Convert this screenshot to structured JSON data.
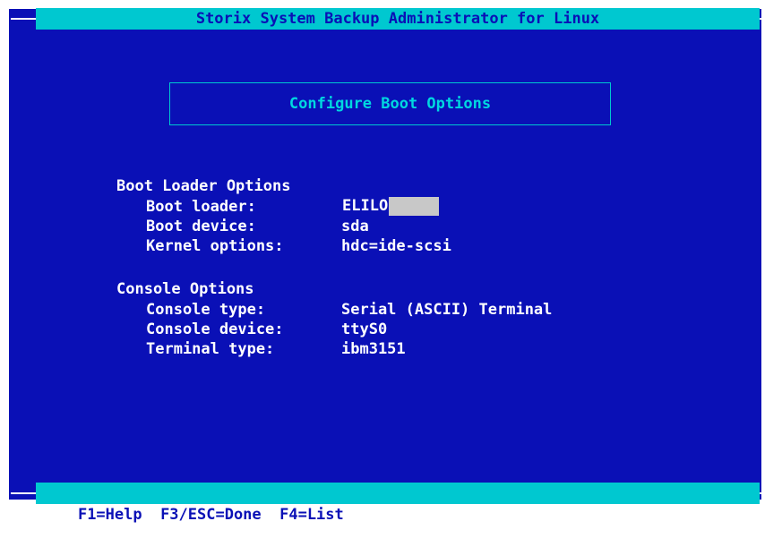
{
  "title": "Storix System Backup Administrator for Linux",
  "screen_title": "Configure Boot Options",
  "sections": [
    {
      "heading": "Boot Loader Options",
      "fields": [
        {
          "label": "Boot loader:",
          "value": "ELILO"
        },
        {
          "label": "Boot device:",
          "value": "sda"
        },
        {
          "label": "Kernel options:",
          "value": "hdc=ide-scsi"
        }
      ]
    },
    {
      "heading": "Console Options",
      "fields": [
        {
          "label": "Console type:",
          "value": "Serial (ASCII) Terminal"
        },
        {
          "label": "Console device:",
          "value": "ttyS0"
        },
        {
          "label": "Terminal type:",
          "value": "ibm3151"
        }
      ]
    }
  ],
  "footer": {
    "keys": "F1=Help  F3/ESC=Done  F4=List"
  },
  "colors": {
    "background": "#0a10b6",
    "bar": "#00c8d0",
    "text": "#ffffff",
    "active_field": "#c8c8c8"
  }
}
